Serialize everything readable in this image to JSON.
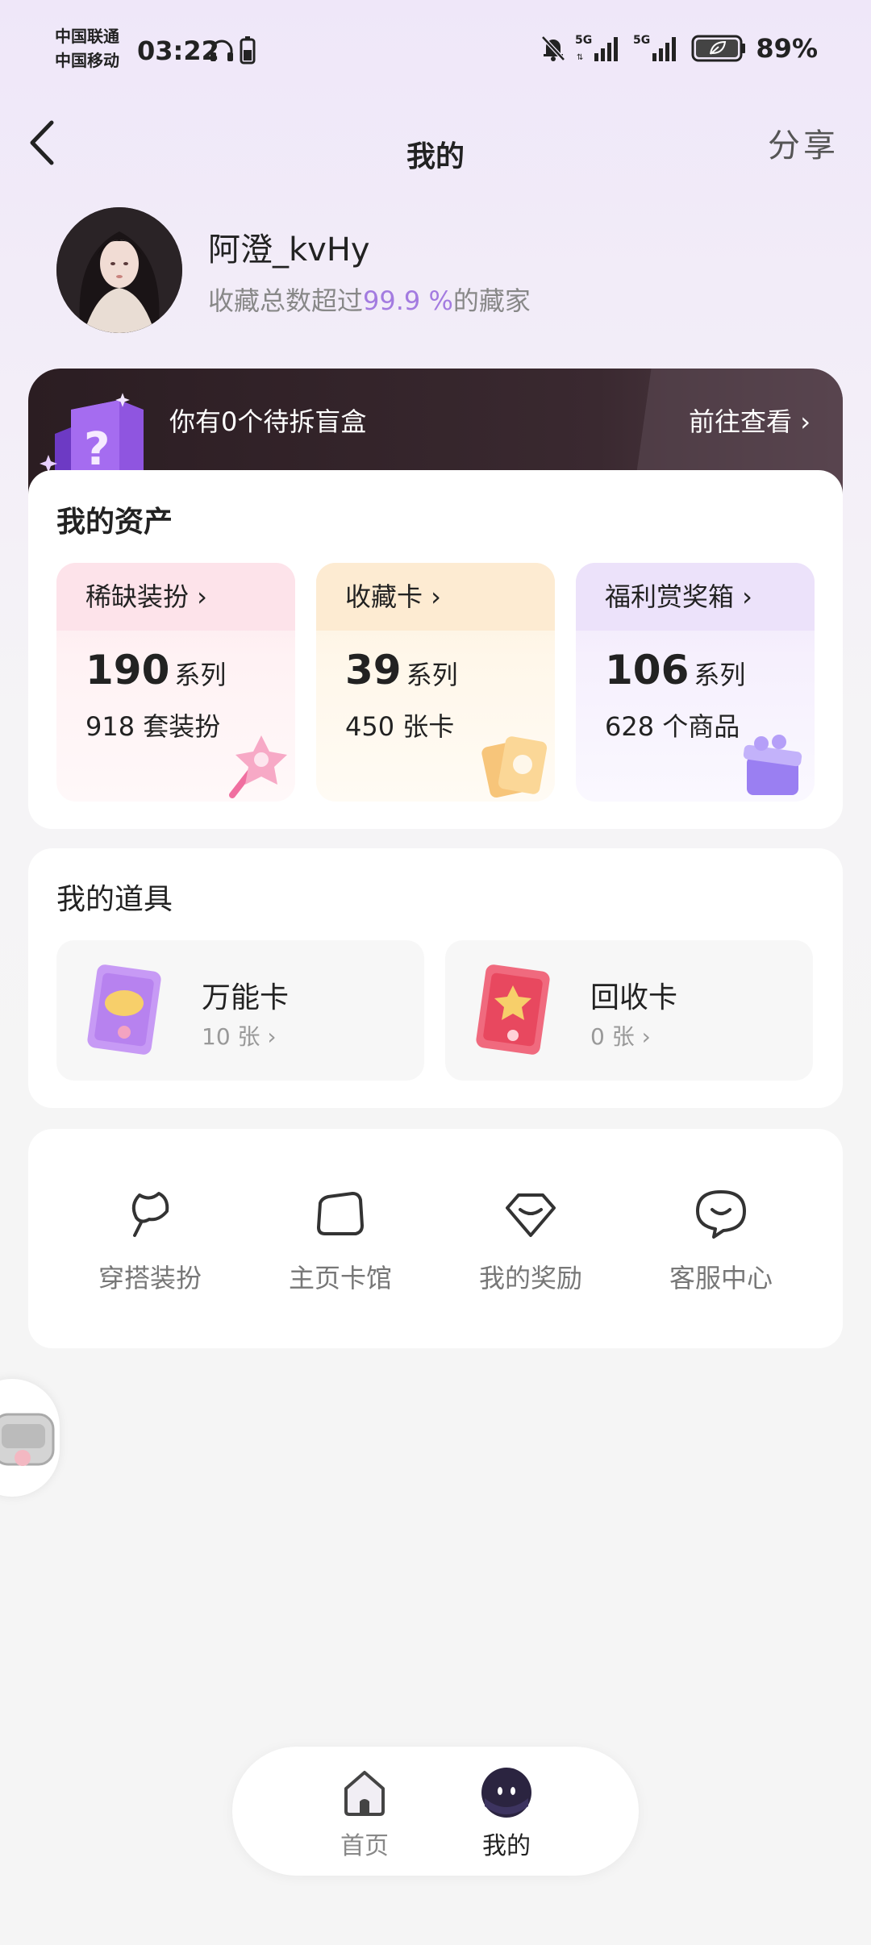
{
  "status_bar": {
    "carrier1": "中国联通",
    "carrier2": "中国移动",
    "time": "03:22",
    "battery": "89%",
    "icons": [
      "headphone-icon",
      "battery-small-icon",
      "mute-bell-icon",
      "signal-5g-icon",
      "signal-5g-icon",
      "battery-icon"
    ]
  },
  "header": {
    "title": "我的",
    "share": "分享",
    "back_icon": "chevron-left-icon"
  },
  "profile": {
    "username": "阿澄_kvHy",
    "collector_prefix": "收藏总数超过",
    "collector_percent": "99.9 %",
    "collector_suffix": "的藏家"
  },
  "blind_box": {
    "text": "你有0个待拆盲盒",
    "link": "前往查看 ›",
    "icon": "mystery-box-icon"
  },
  "assets": {
    "title": "我的资产",
    "tiles": [
      {
        "label": "稀缺装扮 ›",
        "count": "190",
        "unit": "系列",
        "sub": "918 套装扮",
        "icon": "star-wand-icon"
      },
      {
        "label": "收藏卡 ›",
        "count": "39",
        "unit": "系列",
        "sub": "450 张卡",
        "icon": "cards-icon"
      },
      {
        "label": "福利赏奖箱 ›",
        "count": "106",
        "unit": "系列",
        "sub": "628 个商品",
        "icon": "gift-box-icon"
      }
    ]
  },
  "props": {
    "title": "我的道具",
    "items": [
      {
        "name": "万能卡",
        "count": "10 张 ›",
        "icon": "universal-card-icon"
      },
      {
        "name": "回收卡",
        "count": "0 张 ›",
        "icon": "recycle-card-icon"
      }
    ]
  },
  "menu": {
    "items": [
      {
        "label": "穿搭装扮",
        "icon": "outfit-icon"
      },
      {
        "label": "主页卡馆",
        "icon": "card-hall-icon"
      },
      {
        "label": "我的奖励",
        "icon": "reward-icon"
      },
      {
        "label": "客服中心",
        "icon": "customer-service-icon"
      }
    ]
  },
  "bottom_nav": {
    "items": [
      {
        "label": "首页",
        "icon": "home-icon",
        "active": false
      },
      {
        "label": "我的",
        "icon": "profile-face-icon",
        "active": true
      }
    ]
  },
  "colors": {
    "accent_purple": "#a37be0",
    "banner_dark": "#2b1d22"
  }
}
